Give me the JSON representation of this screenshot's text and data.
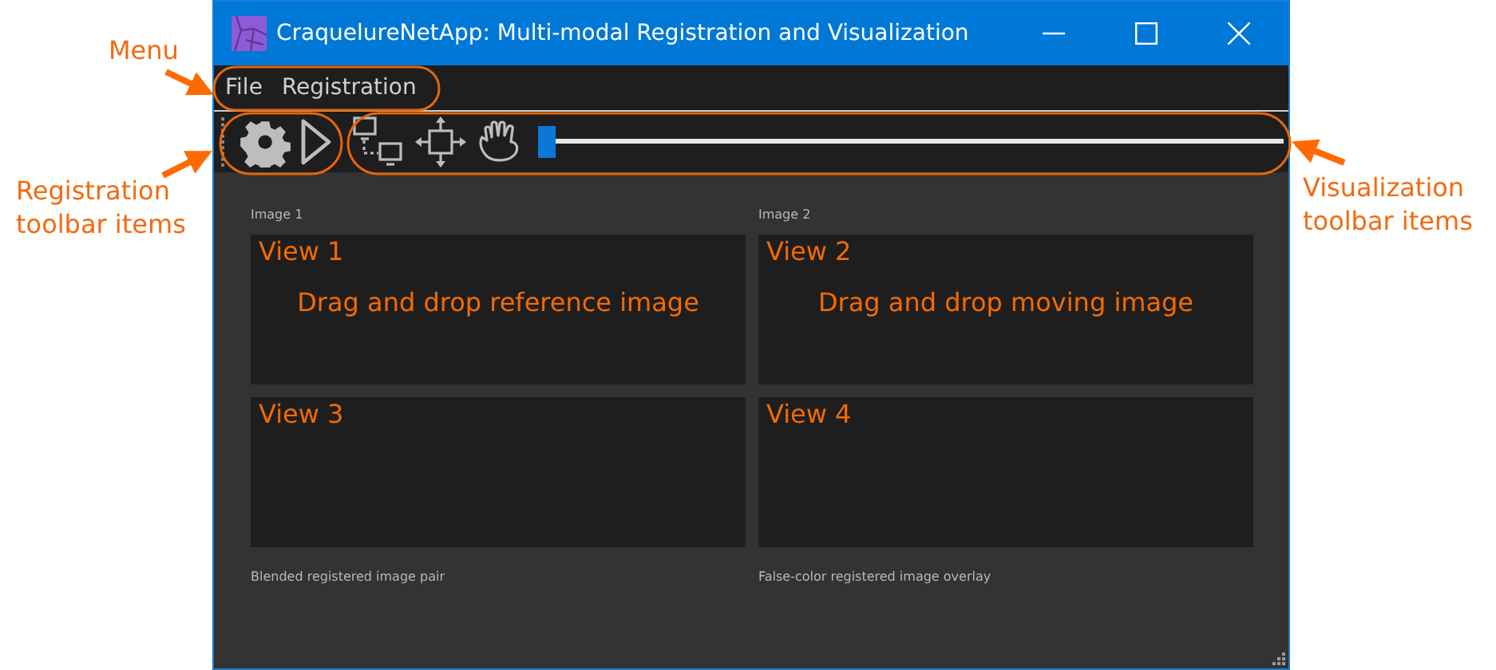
{
  "window": {
    "title": "CraquelureNetApp: Multi-modal Registration and Visualization"
  },
  "menu": [
    {
      "label": "File"
    },
    {
      "label": "Registration"
    }
  ],
  "visualization_toolbar": {
    "slider": {
      "level": 0
    }
  },
  "columns": [
    {
      "label": "Image 1",
      "caption": "Blended registered image pair",
      "views": [
        {
          "title": "View 1",
          "hint": "Drag and drop reference image"
        },
        {
          "title": "View 3"
        }
      ]
    },
    {
      "label": "Image 2",
      "caption": "False-color registered image overlay",
      "views": [
        {
          "title": "View 2",
          "hint": "Drag and drop moving image"
        },
        {
          "title": "View 4"
        }
      ]
    }
  ],
  "annotations": [
    {
      "text": "Menu",
      "kind": "menu"
    },
    {
      "text": "Registration toolbar items",
      "kind": "registration"
    },
    {
      "text": "Visualization toolbar items",
      "kind": "visualization"
    }
  ]
}
